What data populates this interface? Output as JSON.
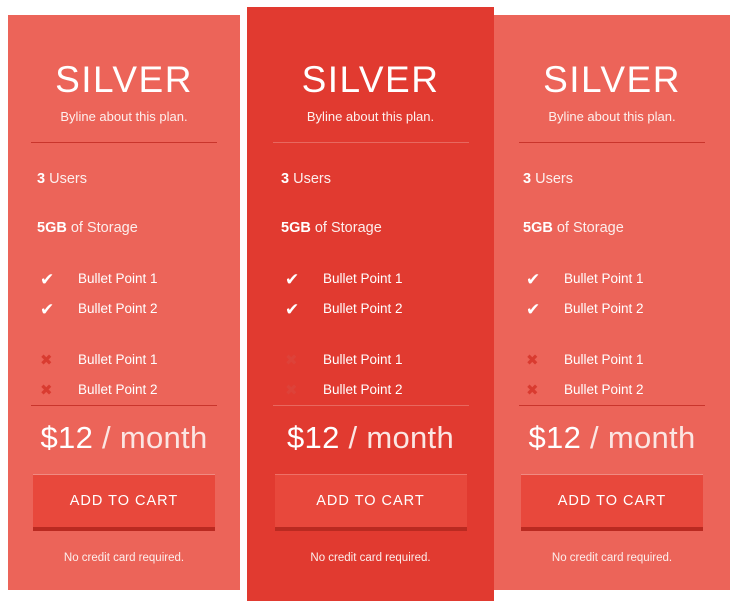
{
  "page": {
    "background": "#ffffff",
    "accent_standard": "#ec6459",
    "accent_featured": "#e13a30",
    "button_color": "#e8483c",
    "button_shadow": "#ba2a21",
    "divider_color": "#c9352c",
    "cross_color": "#d93b30"
  },
  "plans": [
    {
      "variant": "standard",
      "title": "SILVER",
      "byline": "Byline about this plan.",
      "specs": [
        {
          "value": "3",
          "label": "Users"
        },
        {
          "value": "5GB",
          "label": "of Storage"
        }
      ],
      "included": [
        {
          "icon": "check-icon",
          "label": "Bullet Point 1"
        },
        {
          "icon": "check-icon",
          "label": "Bullet Point 2"
        }
      ],
      "excluded": [
        {
          "icon": "cross-icon",
          "label": "Bullet Point 1"
        },
        {
          "icon": "cross-icon",
          "label": "Bullet Point 2"
        }
      ],
      "price_amount": "$12",
      "price_period": "/ month",
      "cart_label": "ADD TO CART",
      "footnote": "No credit card required."
    },
    {
      "variant": "featured",
      "title": "SILVER",
      "byline": "Byline about this plan.",
      "specs": [
        {
          "value": "3",
          "label": "Users"
        },
        {
          "value": "5GB",
          "label": "of Storage"
        }
      ],
      "included": [
        {
          "icon": "check-icon",
          "label": "Bullet Point 1"
        },
        {
          "icon": "check-icon",
          "label": "Bullet Point 2"
        }
      ],
      "excluded": [
        {
          "icon": "cross-icon",
          "label": "Bullet Point 1"
        },
        {
          "icon": "cross-icon",
          "label": "Bullet Point 2"
        }
      ],
      "price_amount": "$12",
      "price_period": "/ month",
      "cart_label": "ADD TO CART",
      "footnote": "No credit card required."
    },
    {
      "variant": "standard",
      "title": "SILVER",
      "byline": "Byline about this plan.",
      "specs": [
        {
          "value": "3",
          "label": "Users"
        },
        {
          "value": "5GB",
          "label": "of Storage"
        }
      ],
      "included": [
        {
          "icon": "check-icon",
          "label": "Bullet Point 1"
        },
        {
          "icon": "check-icon",
          "label": "Bullet Point 2"
        }
      ],
      "excluded": [
        {
          "icon": "cross-icon",
          "label": "Bullet Point 1"
        },
        {
          "icon": "cross-icon",
          "label": "Bullet Point 2"
        }
      ],
      "price_amount": "$12",
      "price_period": "/ month",
      "cart_label": "ADD TO CART",
      "footnote": "No credit card required."
    }
  ],
  "icons": {
    "check-icon": "✔",
    "cross-icon": "✖"
  }
}
